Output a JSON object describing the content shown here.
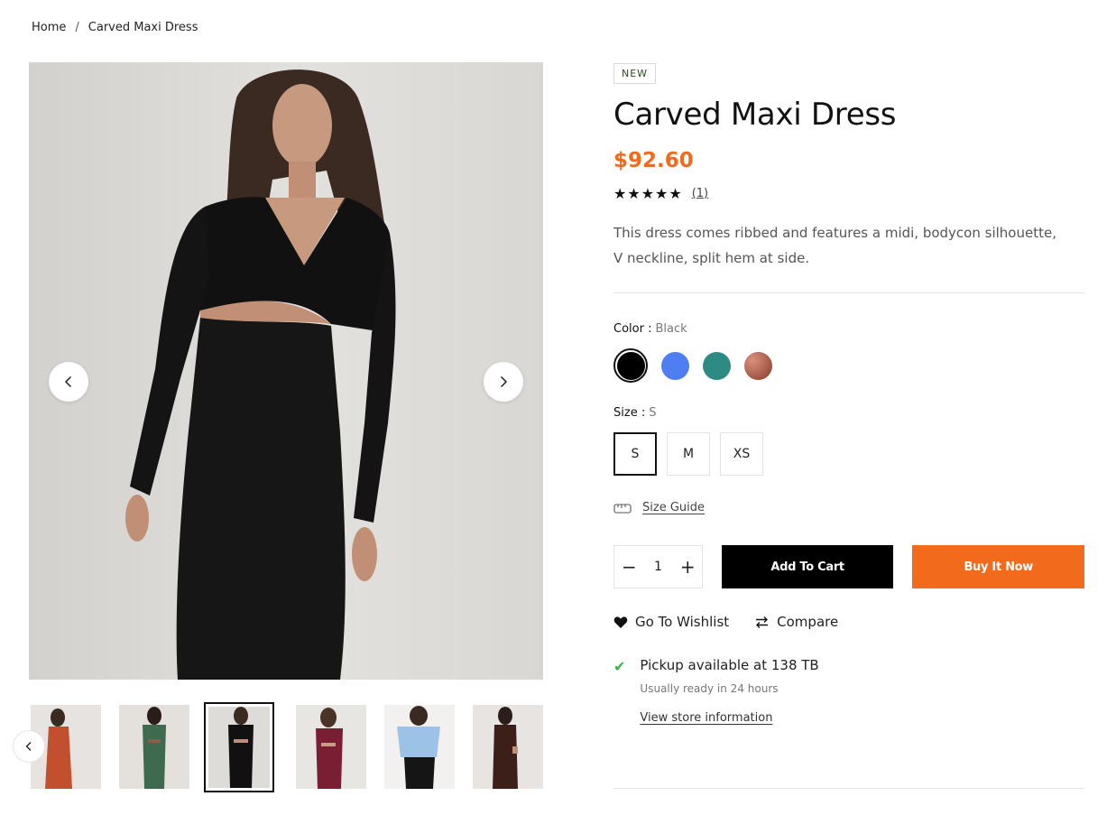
{
  "breadcrumb": {
    "home": "Home",
    "separator": "/",
    "current": "Carved Maxi Dress"
  },
  "product": {
    "badge": "NEW",
    "title": "Carved Maxi Dress",
    "price": "$92.60",
    "stars": "★★★★★",
    "review_count": "(1)",
    "description": "This dress comes ribbed and features a midi, bodycon silhouette, V neckline, split hem at side."
  },
  "color": {
    "label": "Color :",
    "selected": "Black",
    "swatches": [
      "#000000",
      "#4f7df2",
      "#2e8b84",
      "#b5594a"
    ]
  },
  "size": {
    "label": "Size :",
    "selected": "S",
    "options": [
      "S",
      "M",
      "XS"
    ],
    "guide": "Size Guide"
  },
  "purchase": {
    "qty_minus": "−",
    "qty_value": "1",
    "qty_plus": "+",
    "add_to_cart": "Add To Cart",
    "buy_now": "Buy It Now"
  },
  "actions": {
    "wishlist": "Go To Wishlist",
    "compare": "Compare"
  },
  "pickup": {
    "title": "Pickup available at 138 TB",
    "subtitle": "Usually ready in 24 hours",
    "link": "View store information"
  },
  "colors": {
    "accent": "#f26a1b",
    "text": "#111111",
    "success": "#3bb54a"
  },
  "icons": [
    "chevron-left-icon",
    "chevron-right-icon",
    "ruler-icon",
    "heart-icon",
    "compare-arrows-icon",
    "check-icon"
  ]
}
